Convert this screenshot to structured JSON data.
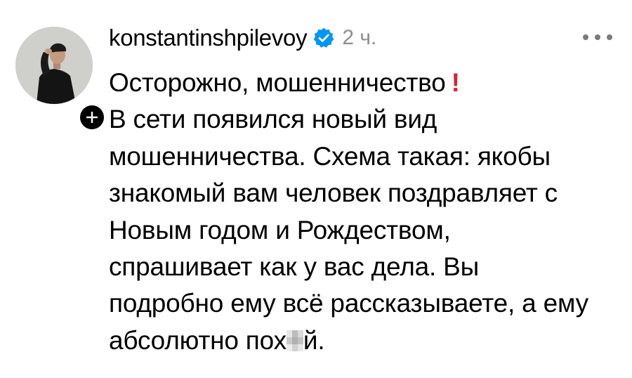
{
  "post": {
    "username": "konstantinshpilevoy",
    "time": "2 ч.",
    "title": "Осторожно, мошенничество",
    "title_emoji": "!",
    "lines": [
      "В сети появился новый вид",
      "мошенничества. Схема такая: якобы",
      "знакомый вам человек поздравляет с",
      "Новым годом и Рождеством,",
      "спрашивает как у вас дела. Вы",
      "подробно ему всё рассказываете, а ему"
    ],
    "last_line_start": "абсолютно пох",
    "last_line_end": "й."
  },
  "icons": {
    "avatar": "avatar-man-in-black-shirt-cap",
    "follow": "plus-icon",
    "verified": "verified-badge-icon",
    "more": "more-dots-icon"
  },
  "colors": {
    "verified": "#0095f6",
    "time": "#8e8e8e",
    "exclaim": "#e0202b"
  }
}
